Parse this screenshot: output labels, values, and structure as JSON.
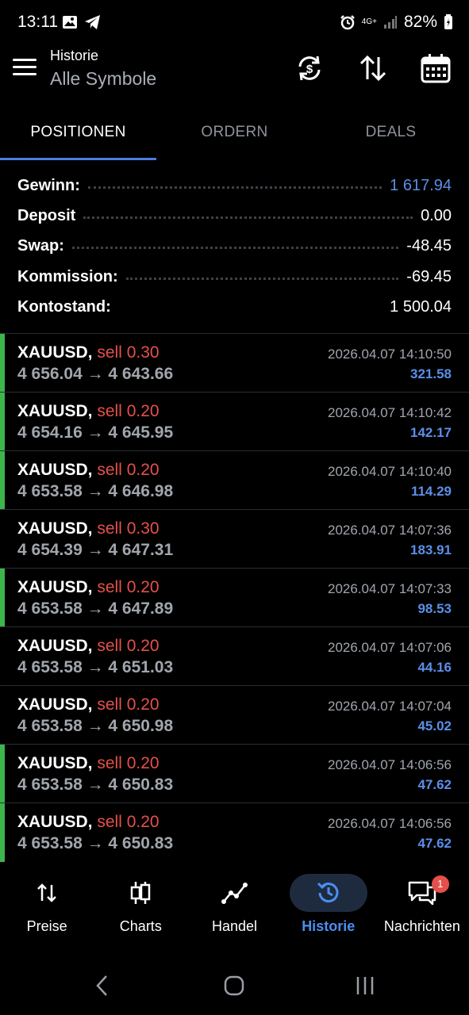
{
  "status_bar": {
    "time": "13:11",
    "network": "4G+",
    "battery": "82%"
  },
  "header": {
    "title": "Historie",
    "subtitle": "Alle Symbole"
  },
  "tabs": [
    {
      "label": "POSITIONEN",
      "active": true
    },
    {
      "label": "ORDERN",
      "active": false
    },
    {
      "label": "DEALS",
      "active": false
    }
  ],
  "summary": [
    {
      "label": "Gewinn:",
      "value": "1 617.94",
      "highlight": true
    },
    {
      "label": "Deposit",
      "value": "0.00",
      "highlight": false
    },
    {
      "label": "Swap:",
      "value": "-48.45",
      "highlight": false
    },
    {
      "label": "Kommission:",
      "value": "-69.45",
      "highlight": false
    },
    {
      "label": "Kontostand:",
      "value": "1 500.04",
      "highlight": false
    }
  ],
  "trades": [
    {
      "symbol": "XAUUSD,",
      "side": "sell 0.30",
      "prices": "4 656.04 → 4 643.66",
      "time": "2026.04.07 14:10:50",
      "profit": "321.58",
      "marker": true
    },
    {
      "symbol": "XAUUSD,",
      "side": "sell 0.20",
      "prices": "4 654.16 → 4 645.95",
      "time": "2026.04.07 14:10:42",
      "profit": "142.17",
      "marker": true
    },
    {
      "symbol": "XAUUSD,",
      "side": "sell 0.20",
      "prices": "4 653.58 → 4 646.98",
      "time": "2026.04.07 14:10:40",
      "profit": "114.29",
      "marker": true
    },
    {
      "symbol": "XAUUSD,",
      "side": "sell 0.30",
      "prices": "4 654.39 → 4 647.31",
      "time": "2026.04.07 14:07:36",
      "profit": "183.91",
      "marker": false
    },
    {
      "symbol": "XAUUSD,",
      "side": "sell 0.20",
      "prices": "4 653.58 → 4 647.89",
      "time": "2026.04.07 14:07:33",
      "profit": "98.53",
      "marker": true
    },
    {
      "symbol": "XAUUSD,",
      "side": "sell 0.20",
      "prices": "4 653.58 → 4 651.03",
      "time": "2026.04.07 14:07:06",
      "profit": "44.16",
      "marker": false
    },
    {
      "symbol": "XAUUSD,",
      "side": "sell 0.20",
      "prices": "4 653.58 → 4 650.98",
      "time": "2026.04.07 14:07:04",
      "profit": "45.02",
      "marker": false
    },
    {
      "symbol": "XAUUSD,",
      "side": "sell 0.20",
      "prices": "4 653.58 → 4 650.83",
      "time": "2026.04.07 14:06:56",
      "profit": "47.62",
      "marker": true
    },
    {
      "symbol": "XAUUSD,",
      "side": "sell 0.20",
      "prices": "4 653.58 → 4 650.83",
      "time": "2026.04.07 14:06:56",
      "profit": "47.62",
      "marker": true
    }
  ],
  "bottom_nav": [
    {
      "label": "Preise",
      "icon": "arrows-updown-icon",
      "active": false
    },
    {
      "label": "Charts",
      "icon": "candlestick-icon",
      "active": false
    },
    {
      "label": "Handel",
      "icon": "trend-line-icon",
      "active": false
    },
    {
      "label": "Historie",
      "icon": "history-icon",
      "active": true
    },
    {
      "label": "Nachrichten",
      "icon": "chat-icon",
      "active": false,
      "badge": "1"
    }
  ],
  "colors": {
    "accent_blue": "#4a7de0",
    "profit_blue": "#5b8fe8",
    "sell_red": "#e5504a",
    "marker_green": "#3cb54a"
  }
}
